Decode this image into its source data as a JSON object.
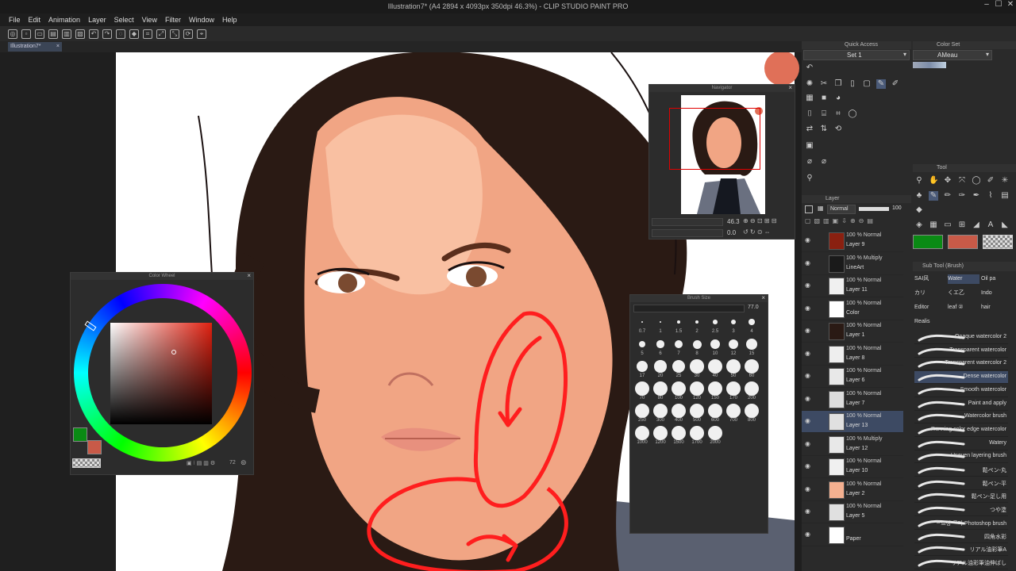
{
  "window": {
    "title": "Illustration7* (A4 2894 x 4093px 350dpi 46.3%) - CLIP STUDIO PAINT PRO",
    "minimize": "–",
    "maximize": "☐",
    "close": "✕"
  },
  "menu": {
    "items": [
      "File",
      "Edit",
      "Animation",
      "Layer",
      "Select",
      "View",
      "Filter",
      "Window",
      "Help"
    ]
  },
  "document_tab": {
    "label": "Illustration7*",
    "close": "×"
  },
  "colors": {
    "main_color": "#0a8a14",
    "sub_color": "#c85a48",
    "accent": "#3d4a63",
    "stroke_red": "#ff1e1e"
  },
  "color_wheel": {
    "title": "Color Wheel",
    "footer": "72"
  },
  "navigator": {
    "title": "Navigator",
    "zoom": "46.3",
    "angle": "0.0"
  },
  "brush_size": {
    "title": "Brush Size",
    "value": "77.0",
    "sizes": [
      "0.7",
      "1",
      "1.5",
      "2",
      "2.5",
      "3",
      "4",
      "5",
      "6",
      "7",
      "8",
      "10",
      "12",
      "15",
      "17",
      "20",
      "25",
      "30",
      "40",
      "50",
      "60",
      "70",
      "80",
      "100",
      "120",
      "150",
      "170",
      "200",
      "250",
      "300",
      "400",
      "500",
      "600",
      "700",
      "800",
      "1000",
      "1200",
      "1500",
      "1700",
      "2000"
    ]
  },
  "quick_access": {
    "title": "Quick Access",
    "set": "Set 1"
  },
  "color_set": {
    "title": "Color Set",
    "set": "AMeau"
  },
  "tool": {
    "title": "Tool"
  },
  "layer": {
    "title": "Layer",
    "blend_mode": "Normal",
    "opacity": "100",
    "layers": [
      {
        "mode": "100 % Normal",
        "name": "Layer 9"
      },
      {
        "mode": "100 % Multiply",
        "name": "LineArt"
      },
      {
        "mode": "100 % Normal",
        "name": "Layer 11"
      },
      {
        "mode": "100 % Normal",
        "name": "Color"
      },
      {
        "mode": "100 % Normal",
        "name": "Layer 1"
      },
      {
        "mode": "100 % Normal",
        "name": "Layer 8"
      },
      {
        "mode": "100 % Normal",
        "name": "Layer 6"
      },
      {
        "mode": "100 % Normal",
        "name": "Layer 7"
      },
      {
        "mode": "100 % Normal",
        "name": "Layer 13"
      },
      {
        "mode": "100 % Multiply",
        "name": "Layer 12"
      },
      {
        "mode": "100 % Normal",
        "name": "Layer 10"
      },
      {
        "mode": "100 % Normal",
        "name": "Layer 2"
      },
      {
        "mode": "100 % Normal",
        "name": "Layer 5"
      },
      {
        "mode": "",
        "name": "Paper"
      }
    ]
  },
  "sub_tool": {
    "title": "Sub Tool (Brush)",
    "tabs": [
      "SAI风",
      "Water",
      "Oil pa",
      "カリ",
      "くエ乙",
      "Indo",
      "Editor",
      "leaf ②",
      "hair",
      "Realis"
    ],
    "brushes": [
      "Opaque watercolor 2",
      "Transparent watercolor",
      "Transparent watercolor 2",
      "Dense watercolor",
      "Smooth watercolor",
      "Paint and apply",
      "Watercolor brush",
      "Running color edge watercolor",
      "Watery",
      "Uneven layering brush",
      "鬆ペン-丸",
      "鬆ペン-平",
      "鬆ペン-足し用",
      "つや塗",
      "ᄑ르상 ᄀ마 Photoshop brush",
      "四角水彩",
      "リアル油彩筆A",
      "リアル油彩筆油伸ばし"
    ]
  }
}
